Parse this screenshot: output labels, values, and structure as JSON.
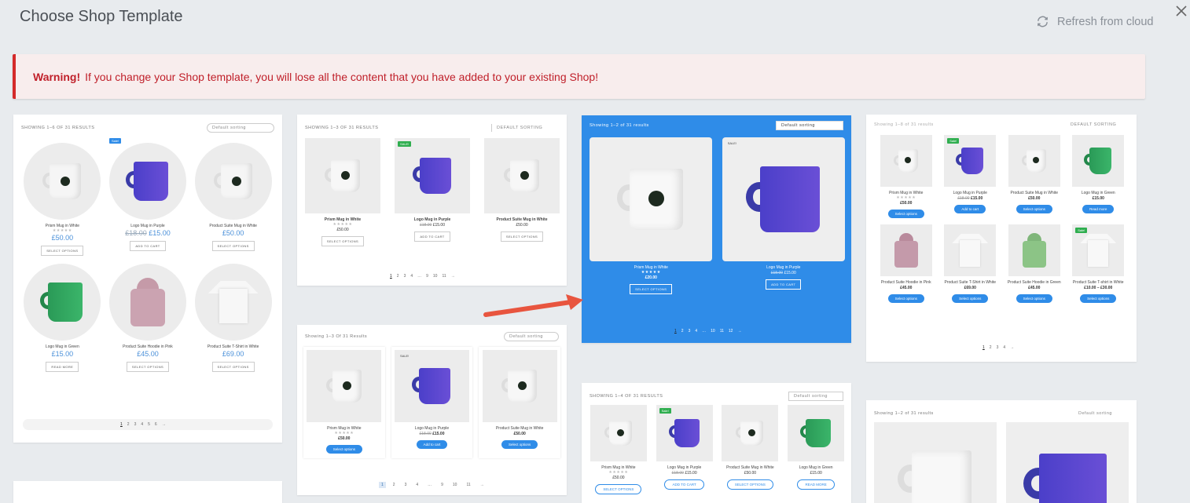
{
  "header": {
    "title": "Choose Shop Template",
    "refresh_label": "Refresh from cloud"
  },
  "warning": {
    "label": "Warning!",
    "message": "If you change your Shop template, you will lose all the content that you have added to your existing Shop!"
  },
  "colors": {
    "accent": "#2f8ce8",
    "warning": "#c0202a",
    "warning_bg": "#f8eded",
    "arrow": "#e8553f"
  },
  "templates": [
    {
      "id": "template-1",
      "result_count": "SHOWING 1–6 OF 31 RESULTS",
      "sorting": "Default sorting",
      "products": [
        {
          "name": "Prism Mug in White",
          "price": "£50.00",
          "old_price": "",
          "button": "SELECT OPTIONS",
          "badge": ""
        },
        {
          "name": "Logo Mug in Purple",
          "price": "£15.00",
          "old_price": "£18.00",
          "button": "ADD TO CART",
          "badge": "Sale!"
        },
        {
          "name": "Product Suite Mug in White",
          "price": "£50.00",
          "old_price": "",
          "button": "SELECT OPTIONS",
          "badge": ""
        },
        {
          "name": "Logo Mug in Green",
          "price": "£15.00",
          "old_price": "",
          "button": "READ MORE",
          "badge": ""
        },
        {
          "name": "Product Suite Hoodie in Pink",
          "price": "£45.00",
          "old_price": "",
          "button": "SELECT OPTIONS",
          "badge": ""
        },
        {
          "name": "Product Suite T-Shirt in White",
          "price": "£69.00",
          "old_price": "",
          "button": "SELECT OPTIONS",
          "badge": ""
        }
      ],
      "pages": [
        "1",
        "2",
        "3",
        "4",
        "5",
        "6",
        "→"
      ]
    },
    {
      "id": "template-2",
      "result_count": "SHOWING 1–3 OF 31 RESULTS",
      "sorting": "DEFAULT SORTING",
      "products": [
        {
          "name": "Prism Mug in White",
          "price": "£50.00",
          "old_price": "",
          "button": "SELECT OPTIONS",
          "badge": ""
        },
        {
          "name": "Logo Mug in Purple",
          "price": "£15.00",
          "old_price": "£18.00",
          "button": "ADD TO CART",
          "badge": "SALE!"
        },
        {
          "name": "Product Suite Mug in White",
          "price": "£50.00",
          "old_price": "",
          "button": "SELECT OPTIONS",
          "badge": ""
        }
      ],
      "pages": [
        "1",
        "2",
        "3",
        "4",
        "…",
        "9",
        "10",
        "11",
        "→"
      ]
    },
    {
      "id": "template-3",
      "result_count": "Showing 1–2 of 31 results",
      "sorting": "Default sorting",
      "products": [
        {
          "name": "Prism Mug in White",
          "price": "£20.00",
          "old_price": "",
          "button": "SELECT OPTIONS",
          "badge": ""
        },
        {
          "name": "Logo Mug in Purple",
          "price": "£15.00",
          "old_price": "£18.00",
          "button": "ADD TO CART",
          "badge": "SALE!"
        }
      ],
      "pages": [
        "1",
        "2",
        "3",
        "4",
        "…",
        "10",
        "11",
        "12",
        "→"
      ]
    },
    {
      "id": "template-4",
      "result_count": "Showing 1–8 of 31 results",
      "sorting": "DEFAULT SORTING",
      "products": [
        {
          "name": "Prism Mug in White",
          "price": "£50.00",
          "old_price": "",
          "button": "Select options",
          "badge": ""
        },
        {
          "name": "Logo Mug in Purple",
          "price": "£15.00",
          "old_price": "£18.00",
          "button": "Add to cart",
          "badge": "Sale!"
        },
        {
          "name": "Product Suite Mug in White",
          "price": "£50.00",
          "old_price": "",
          "button": "Select options",
          "badge": ""
        },
        {
          "name": "Logo Mug in Green",
          "price": "£15.00",
          "old_price": "",
          "button": "Read more",
          "badge": ""
        },
        {
          "name": "Product Suite Hoodie in Pink",
          "price": "£45.00",
          "old_price": "",
          "button": "Select options",
          "badge": ""
        },
        {
          "name": "Product Suite T-Shirt in White",
          "price": "£69.00",
          "old_price": "",
          "button": "Select options",
          "badge": ""
        },
        {
          "name": "Product Suite Hoodie in Green",
          "price": "£45.00",
          "old_price": "",
          "button": "Select options",
          "badge": ""
        },
        {
          "name": "Product Suite T-shirt in White",
          "price": "£10.00 – £30.00",
          "old_price": "",
          "button": "Select options",
          "badge": "Sale!"
        }
      ],
      "pages": [
        "1",
        "2",
        "3",
        "4",
        "→"
      ]
    },
    {
      "id": "template-5",
      "result_count": "Showing 1–3 Of 31 Results",
      "sorting": "Default sorting",
      "products": [
        {
          "name": "Prism Mug in White",
          "price": "£50.00",
          "old_price": "",
          "button": "Select options",
          "badge": ""
        },
        {
          "name": "Logo Mug in Purple",
          "price": "£15.00",
          "old_price": "£18.00",
          "button": "Add to cart",
          "badge": "SALE!"
        },
        {
          "name": "Product Suite Mug in White",
          "price": "£50.00",
          "old_price": "",
          "button": "Select options",
          "badge": ""
        }
      ],
      "pages": [
        "1",
        "2",
        "3",
        "4",
        "…",
        "9",
        "10",
        "11",
        "→"
      ]
    },
    {
      "id": "template-6",
      "result_count": "SHOWING 1–4 OF 31 RESULTS",
      "sorting": "Default sorting",
      "products": [
        {
          "name": "Prism Mug in White",
          "price": "£50.00",
          "old_price": "",
          "button": "SELECT OPTIONS",
          "badge": ""
        },
        {
          "name": "Logo Mug in Purple",
          "price": "£15.00",
          "old_price": "£18.00",
          "button": "ADD TO CART",
          "badge": "Sale!"
        },
        {
          "name": "Product Suite Mug in White",
          "price": "£50.00",
          "old_price": "",
          "button": "SELECT OPTIONS",
          "badge": ""
        },
        {
          "name": "Logo Mug in Green",
          "price": "£15.00",
          "old_price": "",
          "button": "READ MORE",
          "badge": ""
        }
      ]
    },
    {
      "id": "template-7",
      "result_count": "Showing 1–2 of 31 results",
      "sorting": "Default sorting"
    }
  ]
}
